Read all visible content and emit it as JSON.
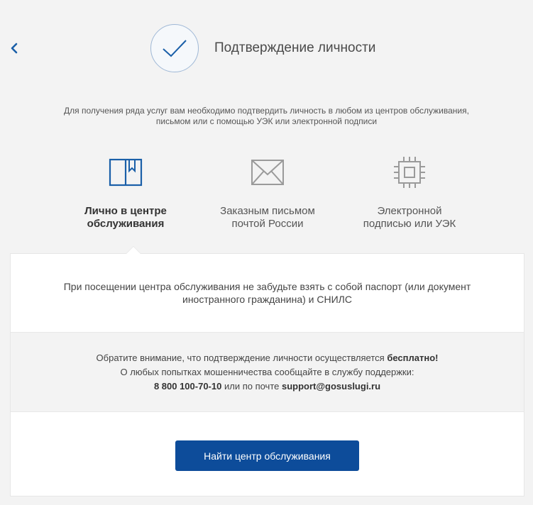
{
  "header": {
    "title": "Подтверждение личности"
  },
  "intro": {
    "line1": "Для получения ряда услуг вам необходимо подтвердить личность в любом из центров обслуживания,",
    "line2": "письмом или с помощью УЭК или электронной подписи"
  },
  "methods": [
    {
      "line1": "Лично в центре",
      "line2": "обслуживания",
      "icon": "book-icon",
      "active": true
    },
    {
      "line1": "Заказным письмом",
      "line2": "почтой России",
      "icon": "envelope-icon",
      "active": false
    },
    {
      "line1": "Электронной",
      "line2": "подписью или УЭК",
      "icon": "chip-icon",
      "active": false
    }
  ],
  "panel": {
    "reminder_line1": "При посещении центра обслуживания не забудьте взять с собой паспорт (или документ",
    "reminder_line2": "иностранного гражданина) и СНИЛС",
    "notice_prefix": "Обратите внимание, что подтверждение личности осуществляется ",
    "notice_bold": "бесплатно!",
    "fraud_line": "О любых попытках мошенничества сообщайте в службу поддержки:",
    "phone": "8 800 100-70-10",
    "or_email_text": " или по почте ",
    "email": "support@gosuslugi.ru",
    "button_label": "Найти центр обслуживания"
  },
  "colors": {
    "accent": "#0d4c9a",
    "icon_blue": "#1a5fa8",
    "icon_gray": "#9a9a9a",
    "background": "#f3f3f3"
  }
}
